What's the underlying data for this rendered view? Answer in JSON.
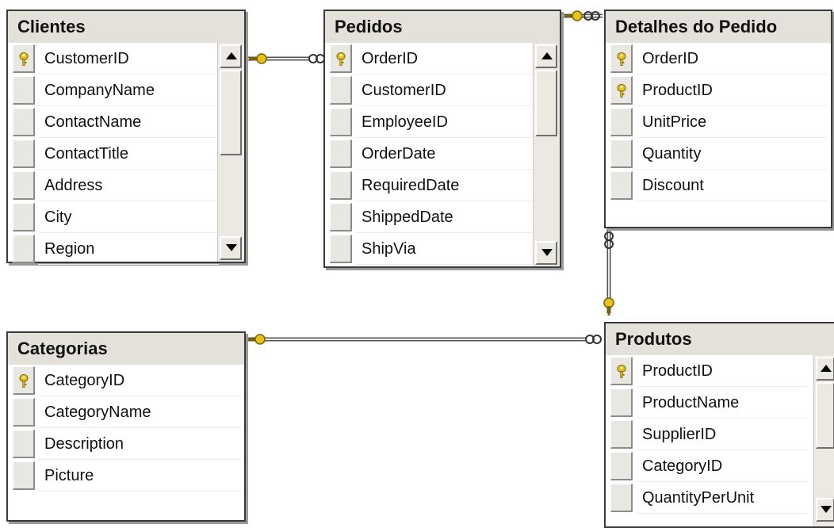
{
  "tables": {
    "clientes": {
      "title": "Clientes",
      "columns": [
        "CustomerID",
        "CompanyName",
        "ContactName",
        "ContactTitle",
        "Address",
        "City",
        "Region"
      ],
      "primary_keys": [
        "CustomerID"
      ]
    },
    "pedidos": {
      "title": "Pedidos",
      "columns": [
        "OrderID",
        "CustomerID",
        "EmployeeID",
        "OrderDate",
        "RequiredDate",
        "ShippedDate",
        "ShipVia"
      ],
      "primary_keys": [
        "OrderID"
      ]
    },
    "detalhes": {
      "title": "Detalhes do Pedido",
      "columns": [
        "OrderID",
        "ProductID",
        "UnitPrice",
        "Quantity",
        "Discount"
      ],
      "primary_keys": [
        "OrderID",
        "ProductID"
      ]
    },
    "categorias": {
      "title": "Categorias",
      "columns": [
        "CategoryID",
        "CategoryName",
        "Description",
        "Picture"
      ],
      "primary_keys": [
        "CategoryID"
      ]
    },
    "produtos": {
      "title": "Produtos",
      "columns": [
        "ProductID",
        "ProductName",
        "SupplierID",
        "CategoryID",
        "QuantityPerUnit"
      ],
      "primary_keys": [
        "ProductID"
      ]
    }
  },
  "relationships": [
    {
      "from": "clientes",
      "to": "pedidos",
      "one_end": "key-icon",
      "many_end": "infinity-icon"
    },
    {
      "from": "pedidos",
      "to": "detalhes",
      "one_end": "key-icon",
      "many_end": "infinity-icon"
    },
    {
      "from": "produtos",
      "to": "detalhes",
      "one_end": "key-icon",
      "many_end": "infinity-icon"
    },
    {
      "from": "categorias",
      "to": "produtos",
      "one_end": "key-icon",
      "many_end": "infinity-icon"
    }
  ],
  "colors": {
    "title_bar": "#e4e1da",
    "key": "#e8c21a",
    "border": "#3a3a3a"
  }
}
